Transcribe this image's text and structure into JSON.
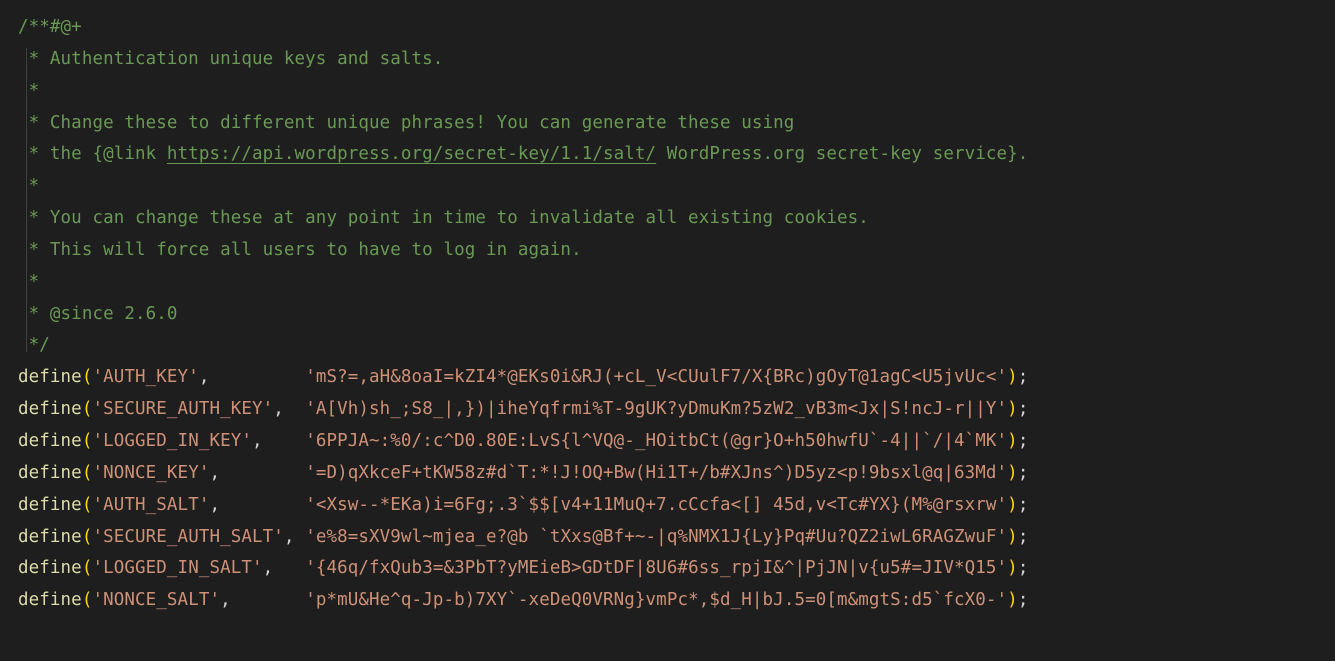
{
  "comment": {
    "l1": "/**#@+",
    "l2": " * Authentication unique keys and salts.",
    "l3": " *",
    "l4": " * Change these to different unique phrases! You can generate these using",
    "l5a": " * the {@link ",
    "l5link": "https://api.wordpress.org/secret-key/1.1/salt/",
    "l5b": " WordPress.org secret-key service}.",
    "l6": " *",
    "l7": " * You can change these at any point in time to invalidate all existing cookies.",
    "l8": " * This will force all users to have to log in again.",
    "l9": " *",
    "l10": " * @since 2.6.0",
    "l11": " */"
  },
  "fn": "define",
  "defines": [
    {
      "key": "'AUTH_KEY'",
      "pad": ",         ",
      "val": "'mS?=,aH&8oaI=kZI4*@EKs0i&RJ(+cL_V<CUulF7/X{BRc)gOyT@1agC<U5jvUc<'"
    },
    {
      "key": "'SECURE_AUTH_KEY'",
      "pad": ",  ",
      "val": "'A[Vh)sh_;S8_|,})|iheYqfrmi%T-9gUK?yDmuKm?5zW2_vB3m<Jx|S!ncJ-r||Y'"
    },
    {
      "key": "'LOGGED_IN_KEY'",
      "pad": ",    ",
      "val": "'6PPJA~:%0/:c^D0.80E:LvS{l^VQ@-_HOitbCt(@gr}O+h50hwfU`-4||`/|4`MK'"
    },
    {
      "key": "'NONCE_KEY'",
      "pad": ",        ",
      "val": "'=D)qXkceF+tKW58z#d`T:*!J!OQ+Bw(Hi1T+/b#XJns^)D5yz<p!9bsxl@q|63Md'"
    },
    {
      "key": "'AUTH_SALT'",
      "pad": ",        ",
      "val": "'<Xsw--*EKa)i=6Fg;.3`$$[v4+11MuQ+7.cCcfa<[] 45d,v<Tc#YX}(M%@rsxrw'"
    },
    {
      "key": "'SECURE_AUTH_SALT'",
      "pad": ", ",
      "val": "'e%8=sXV9wl~mjea_e?@b `tXxs@Bf+~-|q%NMX1J{Ly}Pq#Uu?QZ2iwL6RAGZwuF'"
    },
    {
      "key": "'LOGGED_IN_SALT'",
      "pad": ",   ",
      "val": "'{46q/fxQub3=&3PbT?yMEieB>GDtDF|8U6#6ss_rpjI&^|PjJN|v{u5#=JIV*Q15'"
    },
    {
      "key": "'NONCE_SALT'",
      "pad": ",       ",
      "val": "'p*mU&He^q-Jp-b)7XY`-xeDeQ0VRNg}vmPc*,$d_H|bJ.5=0[m&mgtS:d5`fcX0-'"
    }
  ]
}
